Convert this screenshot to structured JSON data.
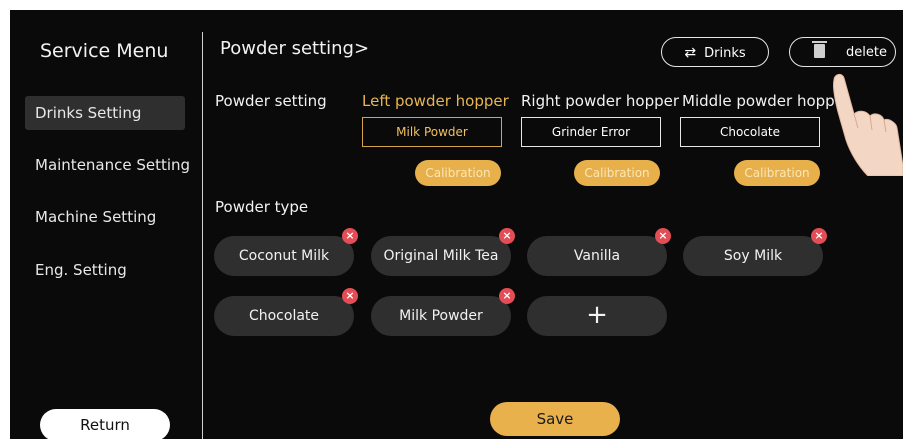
{
  "sidebar": {
    "title": "Service Menu",
    "items": [
      {
        "label": "Drinks Setting",
        "active": true
      },
      {
        "label": "Maintenance Setting",
        "active": false
      },
      {
        "label": "Machine Setting",
        "active": false
      },
      {
        "label": "Eng. Setting",
        "active": false
      }
    ],
    "return_label": "Return"
  },
  "header": {
    "breadcrumb": "Powder setting>",
    "drinks_label": "Drinks",
    "delete_label": "delete"
  },
  "powder_setting": {
    "label": "Powder setting",
    "hoppers": [
      {
        "title": "Left powder hopper",
        "value": "Milk Powder",
        "button": "Calibration",
        "highlight": true
      },
      {
        "title": "Right powder hopper",
        "value": "Grinder Error",
        "button": "Calibration",
        "highlight": false
      },
      {
        "title": "Middle powder hopp",
        "value": "Chocolate",
        "button": "Calibration",
        "highlight": false
      }
    ]
  },
  "powder_type": {
    "label": "Powder type",
    "items": [
      "Coconut Milk",
      "Original Milk Tea",
      "Vanilla",
      "Soy Milk",
      "Chocolate",
      "Milk Powder"
    ],
    "add_label": "+",
    "remove_glyph": "×"
  },
  "save_label": "Save",
  "colors": {
    "background": "#0a0a0a",
    "accent": "#e8b04a",
    "chip": "#2f2f2f",
    "remove": "#e34d55"
  }
}
